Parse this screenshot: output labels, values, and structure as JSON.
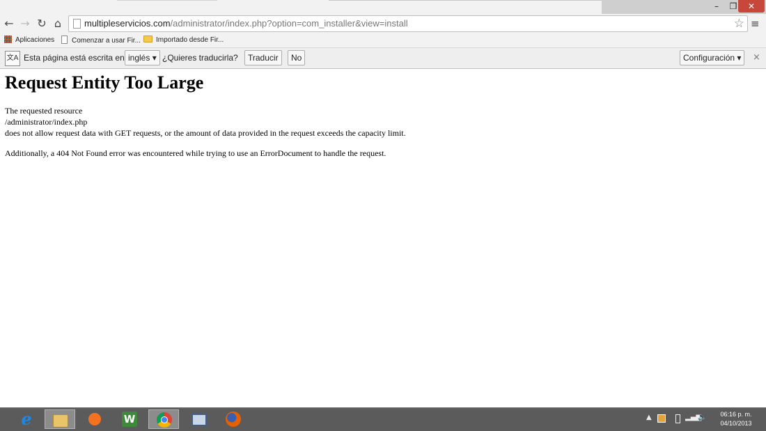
{
  "browser": {
    "url_host": "multipleservicios.com",
    "url_path": "/administrator/index.php?option=com_installer&view=install",
    "window_controls": {
      "minimize": "–",
      "restore": "❐",
      "close": "✕"
    },
    "nav": {
      "back": "←",
      "forward": "→",
      "reload": "↻",
      "home": "⌂",
      "star": "☆",
      "menu": "≡"
    }
  },
  "bookmarks": [
    {
      "label": "Aplicaciones",
      "icon": "apps-grid-icon"
    },
    {
      "label": "Comenzar a usar Fir...",
      "icon": "document-icon"
    },
    {
      "label": "Importado desde Fir...",
      "icon": "folder-icon"
    }
  ],
  "translate_bar": {
    "icon_glyph": "文A",
    "prefix": "Esta página está escrita en",
    "language": "inglés ▾",
    "question": "¿Quieres traducirla?",
    "translate_label": "Traducir",
    "no_label": "No",
    "config_label": "Configuración ▾",
    "close": "×"
  },
  "page": {
    "title": "Request Entity Too Large",
    "lines": [
      "The requested resource",
      "/administrator/index.php",
      "does not allow request data with GET requests, or the amount of data provided in the request exceeds the capacity limit.",
      "Additionally, a 404 Not Found error was encountered while trying to use an ErrorDocument to handle the request."
    ]
  },
  "taskbar": {
    "apps": [
      {
        "name": "internet-explorer-icon",
        "glyph": "e"
      },
      {
        "name": "file-explorer-icon"
      },
      {
        "name": "media-player-icon"
      },
      {
        "name": "word-editor-icon",
        "glyph": "W"
      },
      {
        "name": "chrome-icon",
        "active": true
      },
      {
        "name": "remote-desktop-icon"
      },
      {
        "name": "firefox-icon"
      }
    ],
    "tray": {
      "up_arrow": "▲",
      "signal": "▂▄▆",
      "volume": "🔈"
    },
    "clock_time": "06:16 p. m.",
    "clock_date": "04/10/2013"
  },
  "colors": {
    "close_button": "#c7473a",
    "taskbar": "#5b5b5b",
    "chrome_frame": "#f2f2f2"
  }
}
